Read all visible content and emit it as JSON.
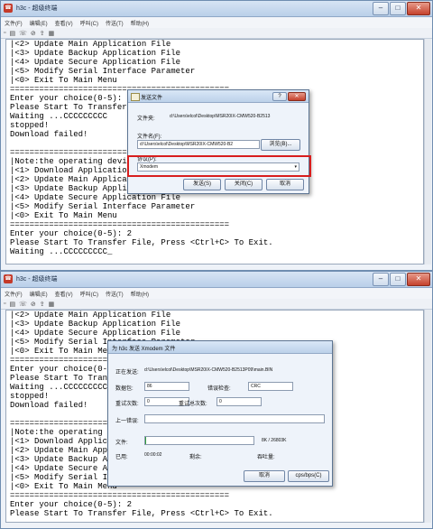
{
  "window": {
    "title": "h3c - 超级终端",
    "menu": [
      "文件(F)",
      "编辑(E)",
      "查看(V)",
      "呼叫(C)",
      "传送(T)",
      "帮助(H)"
    ],
    "toolbar_icons": [
      "new-icon",
      "open-icon",
      "connect-icon",
      "disconnect-icon",
      "send-file-icon",
      "properties-icon"
    ]
  },
  "top": {
    "terminal_lines": [
      "|<2> Update Main Application File",
      "|<3> Update Backup Application File",
      "|<4> Update Secure Application File",
      "|<5> Modify Serial Interface Parameter",
      "|<0> Exit To Main Menu",
      "=============================================",
      "Enter your choice(0-5): 2",
      "Please Start To Transfer File, Press <Ctrl+C> To Exit.",
      "Waiting ...CCCCCCCCC",
      "stopped!",
      "Download failed!",
      "",
      "=============================================",
      "|Note:the operating device is flash                       |",
      "|<1> Download Application Program To SDRAM And Run",
      "|<2> Update Main Application File",
      "|<3> Update Backup Application File",
      "|<4> Update Secure Application File",
      "|<5> Modify Serial Interface Parameter",
      "|<0> Exit To Main Menu",
      "=============================================",
      "Enter your choice(0-5): 2",
      "Please Start To Transfer File, Press <Ctrl+C> To Exit.",
      "Waiting ...CCCCCCCCC_"
    ],
    "send_dialog": {
      "title": "发送文件",
      "folder_label": "文件夹:",
      "folder_value": "d:\\Users\\elcol\\Desktop\\MSR20IX-CMW520-B2513",
      "filename_label": "文件名(F):",
      "filename_value": "d:\\Users\\elcol\\Desktop\\MSR20IX-CMW520-B2",
      "browse_label": "浏览(B)...",
      "protocol_label": "协议(P):",
      "protocol_value": "Xmodem",
      "send_label": "发送(S)",
      "close_label": "关闭(C)",
      "cancel_label": "取消",
      "help_label": "?",
      "close_x": "✕"
    }
  },
  "bottom": {
    "terminal_lines": [
      "|<2> Update Main Application File",
      "|<3> Update Backup Application File",
      "|<4> Update Secure Application File",
      "|<5> Modify Serial Interface Parameter",
      "|<0> Exit To Main Menu",
      "=============================================",
      "Enter your choice(0-5): 2",
      "Please Start To Transfer File, Press <Ctrl+C> To Exit.",
      "Waiting ...CCCCCCCCC",
      "stopped!",
      "Download failed!",
      "",
      "=============================================",
      "|Note:the operating device is flash",
      "|<1> Download Application Program To SDRAM And Run",
      "|<2> Update Main Application File",
      "|<3> Update Backup Application File",
      "|<4> Update Secure Application File",
      "|<5> Modify Serial Interface Parameter",
      "|<0> Exit To Main Menu",
      "=============================================",
      "Enter your choice(0-5): 2",
      "Please Start To Transfer File, Press <Ctrl+C> To Exit."
    ],
    "xmodem_dialog": {
      "title": "为 h3c 发送 Xmodem 文件",
      "sending_label": "正在发送:",
      "sending_value": "d:\\Users\\elcol\\Desktop\\MSR20IX-CMW520-B2513P09\\main.BIN",
      "packet_label": "数据包:",
      "packet_value": "86",
      "error_check_label": "错误检查:",
      "error_check_value": "CRC",
      "retries_label": "重试次数:",
      "retries_value": "0",
      "total_retries_label": "重试总次数:",
      "total_retries_value": "0",
      "last_error_label": "上一错误:",
      "last_error_value": "",
      "file_label": "文件:",
      "file_progress": "8K / 26803K",
      "elapsed_label": "已用:",
      "elapsed_value": "00:00:02",
      "remaining_label": "剩余:",
      "remaining_value": "",
      "throughput_label": "吞吐量:",
      "throughput_value": "",
      "cancel_label": "取消",
      "cps_label": "cps/bps(C)",
      "progress_fraction": 0.0003
    }
  }
}
